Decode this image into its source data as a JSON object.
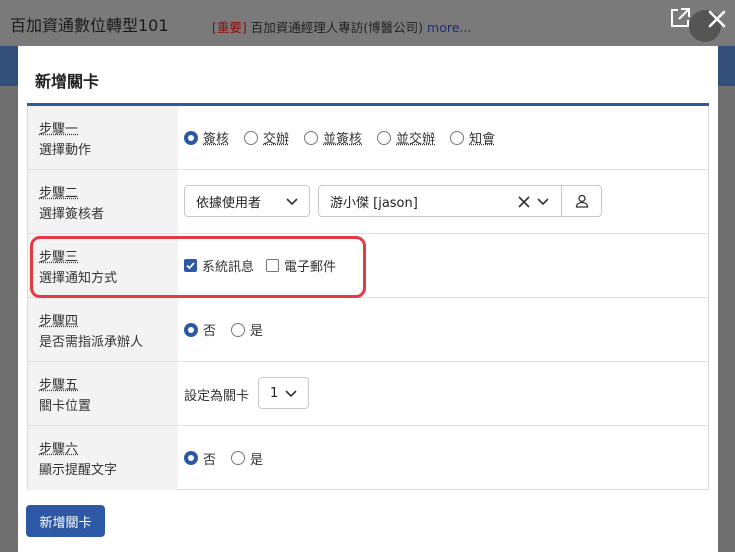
{
  "background": {
    "title": "百加資通數位轉型101",
    "news_tag": "[重要]",
    "news_text": "百加資通經理人專訪(博醫公司)",
    "news_more": "more..."
  },
  "modal": {
    "title": "新增關卡",
    "submit_label": "新增關卡",
    "steps": [
      {
        "step": "步驟一",
        "desc": "選擇動作",
        "options": [
          "簽核",
          "交辦",
          "並簽核",
          "並交辦",
          "知會"
        ],
        "selected": "簽核"
      },
      {
        "step": "步驟二",
        "desc": "選擇簽核者",
        "mode_select": "依據使用者",
        "user_select": "游小傑 [jason]"
      },
      {
        "step": "步驟三",
        "desc": "選擇通知方式",
        "checkboxes": [
          {
            "label": "系統訊息",
            "checked": true
          },
          {
            "label": "電子郵件",
            "checked": false
          }
        ]
      },
      {
        "step": "步驟四",
        "desc": "是否需指派承辦人",
        "options": [
          "否",
          "是"
        ],
        "selected": "否"
      },
      {
        "step": "步驟五",
        "desc": "關卡位置",
        "prefix": "設定為關卡",
        "position_select": "1"
      },
      {
        "step": "步驟六",
        "desc": "顯示提醒文字",
        "options": [
          "否",
          "是"
        ],
        "selected": "否"
      }
    ]
  },
  "colors": {
    "accent": "#2c58a5",
    "highlight": "#e63946"
  },
  "icons": {
    "external": "external-link-icon",
    "close": "close-icon",
    "user": "user-icon",
    "clear": "clear-x-icon",
    "dropdown": "chevron-down-icon"
  }
}
